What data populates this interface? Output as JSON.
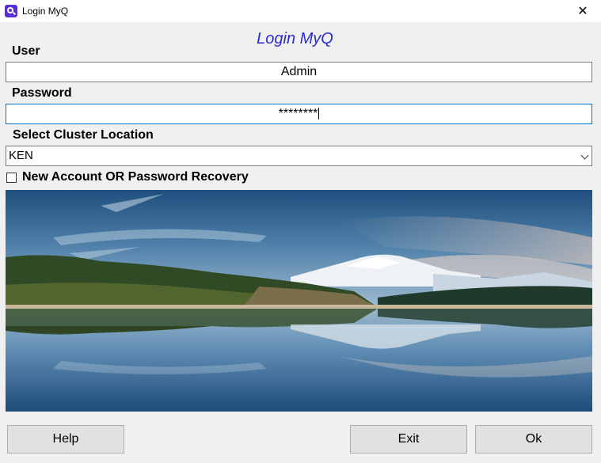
{
  "window": {
    "title": "Login MyQ",
    "close_glyph": "✕",
    "app_icon": "myq-logo-icon"
  },
  "header": {
    "title": "Login MyQ"
  },
  "user": {
    "label": "User",
    "value": "Admin"
  },
  "password": {
    "label": "Password",
    "value": "********"
  },
  "cluster": {
    "label": "Select Cluster Location",
    "selected": "KEN"
  },
  "recovery": {
    "label": "New Account OR Password Recovery",
    "checked": false
  },
  "image": {
    "subject": "mountain-lake-landscape"
  },
  "buttons": {
    "help": "Help",
    "exit": "Exit",
    "ok": "Ok"
  },
  "colors": {
    "header_title": "#2a2ad6",
    "focus_border": "#0078d7"
  }
}
